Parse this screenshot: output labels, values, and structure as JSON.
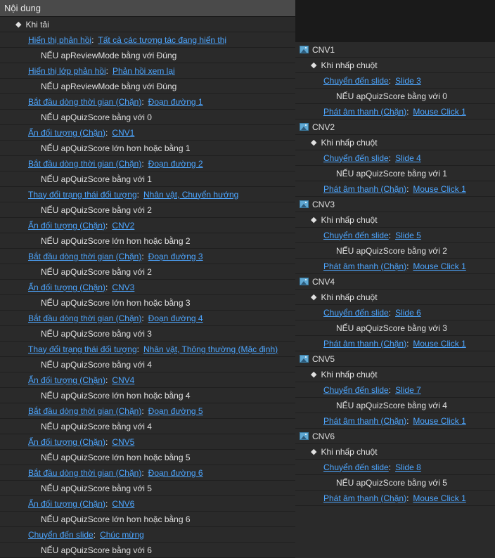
{
  "left": {
    "header": "Nội dung",
    "onload": "Khi tải",
    "rows": [
      {
        "type": "action",
        "a": "Hiển thị phản hồi",
        "b": "Tất cả các tương tác đang hiển thị"
      },
      {
        "type": "cond",
        "t": "NẾU apReviewMode bằng với Đúng"
      },
      {
        "type": "action",
        "a": "Hiển thị lớp phản hồi",
        "b": "Phản hồi xem lại"
      },
      {
        "type": "cond",
        "t": "NẾU apReviewMode bằng với Đúng"
      },
      {
        "type": "action",
        "a": "Bắt đầu dòng thời gian (Chặn)",
        "b": "Đoạn đường 1"
      },
      {
        "type": "cond",
        "t": "NẾU apQuizScore bằng với 0"
      },
      {
        "type": "action",
        "a": "Ẩn đối tượng (Chặn)",
        "b": "CNV1"
      },
      {
        "type": "cond",
        "t": "NẾU apQuizScore lớn hơn hoặc bằng 1"
      },
      {
        "type": "action",
        "a": "Bắt đầu dòng thời gian (Chặn)",
        "b": "Đoạn đường 2"
      },
      {
        "type": "cond",
        "t": "NẾU apQuizScore bằng với 1"
      },
      {
        "type": "action",
        "a": "Thay đổi trạng thái đối tượng",
        "b": "Nhân vật, Chuyển hướng"
      },
      {
        "type": "cond",
        "t": "NẾU apQuizScore bằng với 2"
      },
      {
        "type": "action",
        "a": "Ẩn đối tượng (Chặn)",
        "b": "CNV2"
      },
      {
        "type": "cond",
        "t": "NẾU apQuizScore lớn hơn hoặc bằng 2"
      },
      {
        "type": "action",
        "a": "Bắt đầu dòng thời gian (Chặn)",
        "b": "Đoạn đường 3"
      },
      {
        "type": "cond",
        "t": "NẾU apQuizScore bằng với 2"
      },
      {
        "type": "action",
        "a": "Ẩn đối tượng (Chặn)",
        "b": "CNV3"
      },
      {
        "type": "cond",
        "t": "NẾU apQuizScore lớn hơn hoặc bằng 3"
      },
      {
        "type": "action",
        "a": "Bắt đầu dòng thời gian (Chặn)",
        "b": "Đoạn đường 4"
      },
      {
        "type": "cond",
        "t": "NẾU apQuizScore bằng với 3"
      },
      {
        "type": "action",
        "a": "Thay đổi trạng thái đối tượng",
        "b": "Nhân vật, Thông thường (Mặc định)"
      },
      {
        "type": "cond",
        "t": "NẾU apQuizScore bằng với 4"
      },
      {
        "type": "action",
        "a": "Ẩn đối tượng (Chặn)",
        "b": "CNV4"
      },
      {
        "type": "cond",
        "t": "NẾU apQuizScore lớn hơn hoặc bằng 4"
      },
      {
        "type": "action",
        "a": "Bắt đầu dòng thời gian (Chặn)",
        "b": "Đoạn đường 5"
      },
      {
        "type": "cond",
        "t": "NẾU apQuizScore bằng với 4"
      },
      {
        "type": "action",
        "a": "Ẩn đối tượng (Chặn)",
        "b": "CNV5"
      },
      {
        "type": "cond",
        "t": "NẾU apQuizScore lớn hơn hoặc bằng 5"
      },
      {
        "type": "action",
        "a": "Bắt đầu dòng thời gian (Chặn)",
        "b": "Đoạn đường 6"
      },
      {
        "type": "cond",
        "t": "NẾU apQuizScore bằng với 5"
      },
      {
        "type": "action",
        "a": "Ẩn đối tượng (Chặn)",
        "b": "CNV6"
      },
      {
        "type": "cond",
        "t": "NẾU apQuizScore lớn hơn hoặc bằng 6"
      },
      {
        "type": "action",
        "a": "Chuyển đến slide",
        "b": "Chúc mừng"
      },
      {
        "type": "cond",
        "t": "NẾU apQuizScore bằng với 6"
      }
    ]
  },
  "right": {
    "groups": [
      {
        "name": "CNV1",
        "event": "Khi nhấp chuột",
        "rows": [
          {
            "type": "action",
            "a": "Chuyển đến slide",
            "b": "Slide 3"
          },
          {
            "type": "cond",
            "t": "NẾU apQuizScore bằng với 0"
          },
          {
            "type": "action",
            "a": "Phát âm thanh (Chặn)",
            "b": "Mouse Click 1"
          }
        ]
      },
      {
        "name": "CNV2",
        "event": "Khi nhấp chuột",
        "rows": [
          {
            "type": "action",
            "a": "Chuyển đến slide",
            "b": "Slide 4"
          },
          {
            "type": "cond",
            "t": "NẾU apQuizScore bằng với 1"
          },
          {
            "type": "action",
            "a": "Phát âm thanh (Chặn)",
            "b": "Mouse Click 1"
          }
        ]
      },
      {
        "name": "CNV3",
        "event": "Khi nhấp chuột",
        "rows": [
          {
            "type": "action",
            "a": "Chuyển đến slide",
            "b": "Slide 5"
          },
          {
            "type": "cond",
            "t": "NẾU apQuizScore bằng với 2"
          },
          {
            "type": "action",
            "a": "Phát âm thanh (Chặn)",
            "b": "Mouse Click 1"
          }
        ]
      },
      {
        "name": "CNV4",
        "event": "Khi nhấp chuột",
        "rows": [
          {
            "type": "action",
            "a": "Chuyển đến slide",
            "b": "Slide 6"
          },
          {
            "type": "cond",
            "t": "NẾU apQuizScore bằng với 3"
          },
          {
            "type": "action",
            "a": "Phát âm thanh (Chặn)",
            "b": "Mouse Click 1"
          }
        ]
      },
      {
        "name": "CNV5",
        "event": "Khi nhấp chuột",
        "rows": [
          {
            "type": "action",
            "a": "Chuyển đến slide",
            "b": "Slide 7"
          },
          {
            "type": "cond",
            "t": "NẾU apQuizScore bằng với 4"
          },
          {
            "type": "action",
            "a": "Phát âm thanh (Chặn)",
            "b": "Mouse Click 1"
          }
        ]
      },
      {
        "name": "CNV6",
        "event": "Khi nhấp chuột",
        "rows": [
          {
            "type": "action",
            "a": "Chuyển đến slide",
            "b": "Slide 8"
          },
          {
            "type": "cond",
            "t": "NẾU apQuizScore bằng với 5"
          },
          {
            "type": "action",
            "a": "Phát âm thanh (Chặn)",
            "b": "Mouse Click 1"
          }
        ]
      }
    ]
  }
}
